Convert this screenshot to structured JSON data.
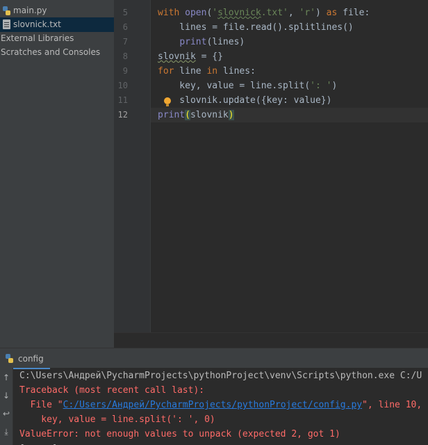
{
  "sidebar": {
    "items": [
      {
        "label": "main.py",
        "icon": "python-file-icon"
      },
      {
        "label": "slovnick.txt",
        "icon": "text-file-icon"
      },
      {
        "label": "External Libraries"
      },
      {
        "label": "Scratches and Consoles"
      }
    ]
  },
  "editor": {
    "line_numbers": [
      "5",
      "6",
      "7",
      "8",
      "9",
      "10",
      "11",
      "12"
    ],
    "current_line": "12"
  },
  "code": {
    "l5": {
      "kw1": "with",
      "bi1": "open",
      "p1": "(",
      "s1": "'",
      "s1w": "slovnick",
      "s1b": ".txt'",
      "c1": ", ",
      "s2": "'r'",
      "p2": ") ",
      "kw2": "as",
      "rest": " file:"
    },
    "l6": {
      "text": "    lines = file.read().splitlines()"
    },
    "l7": {
      "indent": "    ",
      "bi": "print",
      "rest": "(lines)"
    },
    "l8": {
      "w": "slovnik",
      "rest": " = {}"
    },
    "l9": {
      "kw1": "for",
      "m1": " line ",
      "kw2": "in",
      "m2": " lines:"
    },
    "l10": {
      "a": "    key, value = line.split(",
      "s": "': '",
      "b": ")"
    },
    "l11": {
      "a": "    slovnik.update({key: value})"
    },
    "l12": {
      "bi": "print",
      "po": "(",
      "mid": "slovnik",
      "pc": ")"
    }
  },
  "run": {
    "tab_label": "config",
    "lines": {
      "cmd": "C:\\Users\\Андрей\\PycharmProjects\\pythonProject\\venv\\Scripts\\python.exe C:/U",
      "tb": "Traceback (most recent call last):",
      "file_pre": "  File \"",
      "file_link": "C:/Users/Андрей/PycharmProjects/pythonProject/config.py",
      "file_post": "\", line 10,",
      "code": "    key, value = line.split(': ', 0)",
      "err": "ValueError: not enough values to unpack (expected 2, got 1)",
      "partial": "[ ... ]"
    }
  },
  "colors": {
    "keyword": "#cc7832",
    "string": "#6a8759",
    "builtin": "#8888c6",
    "error": "#ff6b68",
    "link": "#287bde"
  }
}
